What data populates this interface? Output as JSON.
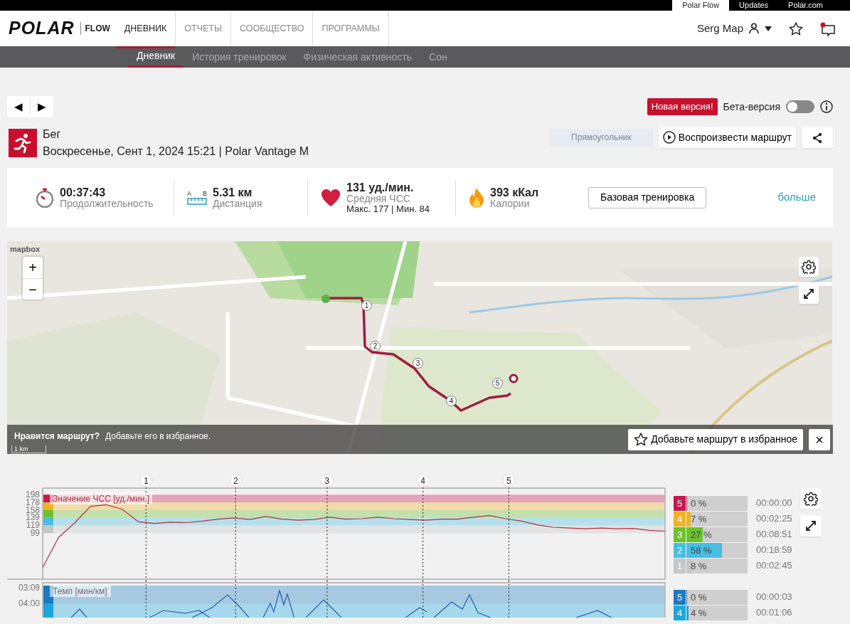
{
  "top_tabs": [
    {
      "label": "Polar Flow",
      "selected": true
    },
    {
      "label": "Updates",
      "selected": false
    },
    {
      "label": "Polar.com",
      "selected": false
    }
  ],
  "navbar": {
    "logo": "POLAR",
    "product": "FLOW",
    "user": "Serg Map",
    "notifications_unread": true,
    "items": [
      {
        "label": "ДНЕВНИК",
        "selected": true
      },
      {
        "label": "ОТЧЕТЫ",
        "selected": false
      },
      {
        "label": "СООБЩЕСТВО",
        "selected": false
      },
      {
        "label": "ПРОГРАММЫ",
        "selected": false
      }
    ]
  },
  "subnav": [
    {
      "label": "Дневник",
      "selected": true
    },
    {
      "label": "История тренировок",
      "selected": false
    },
    {
      "label": "Физическая активность",
      "selected": false
    },
    {
      "label": "Сон",
      "selected": false
    }
  ],
  "pager": [
    "◀",
    "▶"
  ],
  "new_version_badge": "Новая версия!",
  "beta": {
    "label": "Бета-версия",
    "on": false
  },
  "activity": {
    "sport": "Бег",
    "datetime": "Воскресенье, Сент 1, 2024 15:21 | Polar Vantage M",
    "ghost_label": "Прямоугольник",
    "replay_button": "Воспроизвести маршрут"
  },
  "summary": [
    {
      "kind": "duration",
      "value": "00:37:43",
      "label": "Продолжительность"
    },
    {
      "kind": "distance",
      "value": "5.31 км",
      "label": "Дистанция",
      "ends": [
        "A",
        "B"
      ]
    },
    {
      "kind": "heart_rate",
      "value": "131 уд./мин.",
      "label": "Средняя ЧСС",
      "detail": "Макс. 177 | Мин. 84"
    },
    {
      "kind": "calories",
      "value": "393 кКал",
      "label": "Калории"
    }
  ],
  "training_button": "Базовая тренировка",
  "more_link": "больше",
  "map": {
    "logo": "mapbox",
    "zoom": [
      "+",
      "−"
    ],
    "scale": "1 km",
    "route_markers": [
      "1",
      "2",
      "3",
      "4",
      "5"
    ],
    "prompt_question": "Нравится маршрут?",
    "prompt_text": "Добавьте его в избранное.",
    "favorite_button": "Добавьте маршрут в избранное",
    "close": "×"
  },
  "hr_chart": {
    "laps": [
      "1",
      "2",
      "3",
      "4",
      "5"
    ],
    "chart_data": {
      "type": "line",
      "ylim": [
        -20,
        215
      ],
      "yticks": [
        198,
        178,
        158,
        139,
        119,
        99
      ],
      "categories": [
        null,
        null,
        null,
        null,
        null,
        null,
        null,
        null,
        null,
        null,
        null,
        null,
        null,
        null,
        null,
        null,
        null,
        null,
        null,
        null,
        null,
        null,
        null,
        null,
        null,
        null,
        null,
        null,
        null,
        null,
        null,
        null,
        null,
        null,
        null,
        null,
        null,
        null,
        null,
        null
      ],
      "series": [
        {
          "name": "Значение ЧСС [уд./мин.]",
          "color": "#b5303f",
          "values": [
            10,
            88,
            125,
            168,
            172,
            160,
            128,
            124,
            127,
            126,
            130,
            135,
            138,
            134,
            142,
            135,
            132,
            134,
            140,
            135,
            136,
            140,
            136,
            134,
            132,
            135,
            135,
            140,
            144,
            136,
            130,
            120,
            114,
            112,
            110,
            112,
            110,
            111,
            106,
            104
          ]
        }
      ],
      "title": null
    },
    "zones": [
      {
        "zone": "5",
        "color": "#c8174f",
        "share": "0 %",
        "level": 0,
        "time": "00:00:00"
      },
      {
        "zone": "4",
        "color": "#f0b323",
        "share": "7 %",
        "level": 0.07,
        "time": "00:02:25"
      },
      {
        "zone": "3",
        "color": "#6cc12e",
        "share": "27 %",
        "level": 0.27,
        "time": "00:08:51"
      },
      {
        "zone": "2",
        "color": "#49bde2",
        "share": "58 %",
        "level": 0.58,
        "time": "00:18:59"
      },
      {
        "zone": "1",
        "color": "#c4c6c8",
        "share": "8 %",
        "level": 0.08,
        "time": "00:02:45"
      }
    ]
  },
  "pace_chart": {
    "label": "Темп [мин/км]",
    "axis_labels": [
      "03:09",
      "04:00"
    ],
    "zones": [
      {
        "zone": "5",
        "color": "#1a7ac0",
        "share": "0 %",
        "level": 0,
        "time": "00:00:03"
      },
      {
        "zone": "4",
        "color": "#1ba6dc",
        "share": "4 %",
        "level": 0.04,
        "time": "00:01:06"
      }
    ]
  }
}
